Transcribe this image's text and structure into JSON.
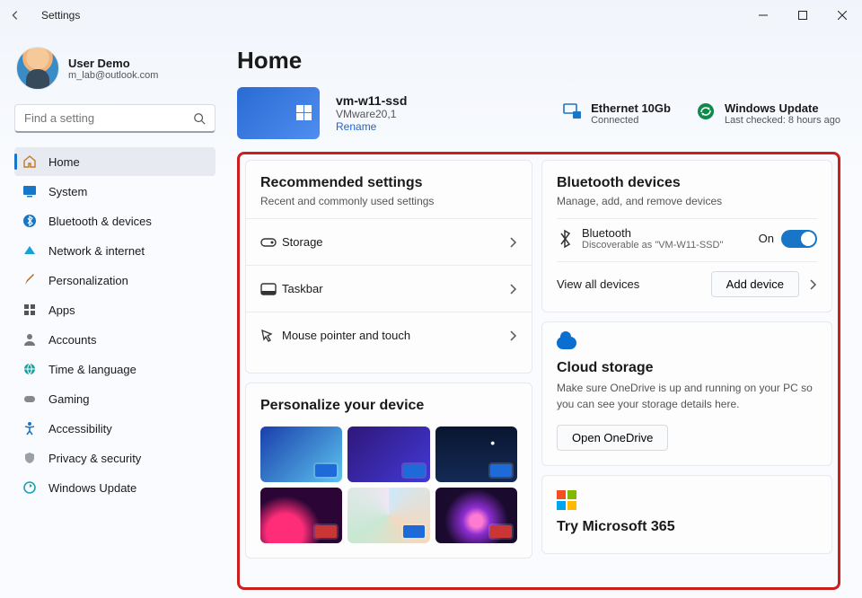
{
  "window": {
    "title": "Settings"
  },
  "user": {
    "name": "User Demo",
    "email": "m_lab@outlook.com"
  },
  "search": {
    "placeholder": "Find a setting"
  },
  "nav": {
    "items": [
      {
        "label": "Home"
      },
      {
        "label": "System"
      },
      {
        "label": "Bluetooth & devices"
      },
      {
        "label": "Network & internet"
      },
      {
        "label": "Personalization"
      },
      {
        "label": "Apps"
      },
      {
        "label": "Accounts"
      },
      {
        "label": "Time & language"
      },
      {
        "label": "Gaming"
      },
      {
        "label": "Accessibility"
      },
      {
        "label": "Privacy & security"
      },
      {
        "label": "Windows Update"
      }
    ]
  },
  "page": {
    "title": "Home"
  },
  "device": {
    "name": "vm-w11-ssd",
    "model": "VMware20,1",
    "rename": "Rename"
  },
  "status": {
    "network": {
      "title": "Ethernet 10Gb",
      "sub": "Connected"
    },
    "update": {
      "title": "Windows Update",
      "sub": "Last checked: 8 hours ago"
    }
  },
  "recommended": {
    "title": "Recommended settings",
    "sub": "Recent and commonly used settings",
    "items": [
      {
        "label": "Storage"
      },
      {
        "label": "Taskbar"
      },
      {
        "label": "Mouse pointer and touch"
      }
    ]
  },
  "personalize": {
    "title": "Personalize your device"
  },
  "bluetooth": {
    "title": "Bluetooth devices",
    "sub": "Manage, add, and remove devices",
    "row_label": "Bluetooth",
    "row_sub": "Discoverable as \"VM-W11-SSD\"",
    "state": "On",
    "view_all": "View all devices",
    "add": "Add device"
  },
  "cloud": {
    "title": "Cloud storage",
    "desc": "Make sure OneDrive is up and running on your PC so you can see your storage details here.",
    "open": "Open OneDrive"
  },
  "m365": {
    "title": "Try Microsoft 365"
  }
}
